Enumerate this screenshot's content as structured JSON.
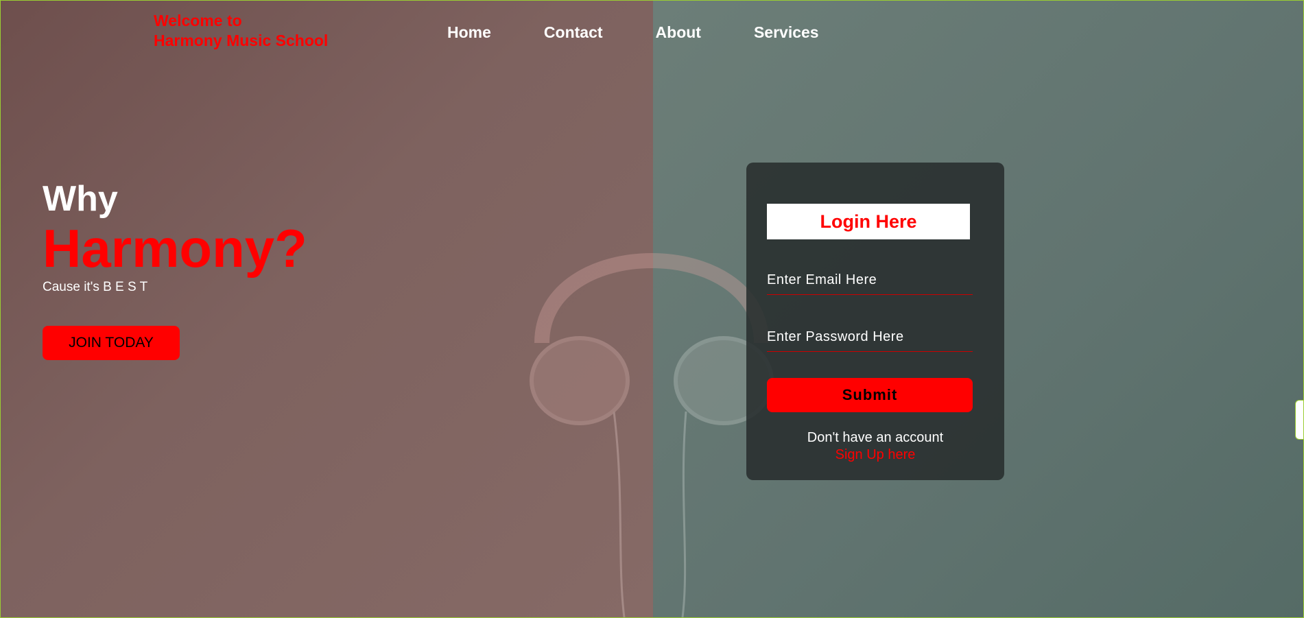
{
  "header": {
    "brand_line1": "Welcome to",
    "brand_line2": "Harmony Music School",
    "nav": [
      "Home",
      "Contact",
      "About",
      "Services"
    ]
  },
  "hero": {
    "why": "Why",
    "harmony": "Harmony?",
    "tagline": "Cause it's B E S T",
    "join_label": "JOIN TODAY"
  },
  "login": {
    "title": "Login Here",
    "email_placeholder": "Enter Email Here",
    "password_placeholder": "Enter Password Here",
    "submit_label": "Submit",
    "no_account_text": "Don't have an account",
    "signup_label": "Sign Up here"
  },
  "colors": {
    "accent": "#ff0000",
    "left_panel": "#7e625f",
    "right_panel": "#617470",
    "login_bg": "#2f3535"
  },
  "icons": {
    "background_image": "headphones-image"
  }
}
